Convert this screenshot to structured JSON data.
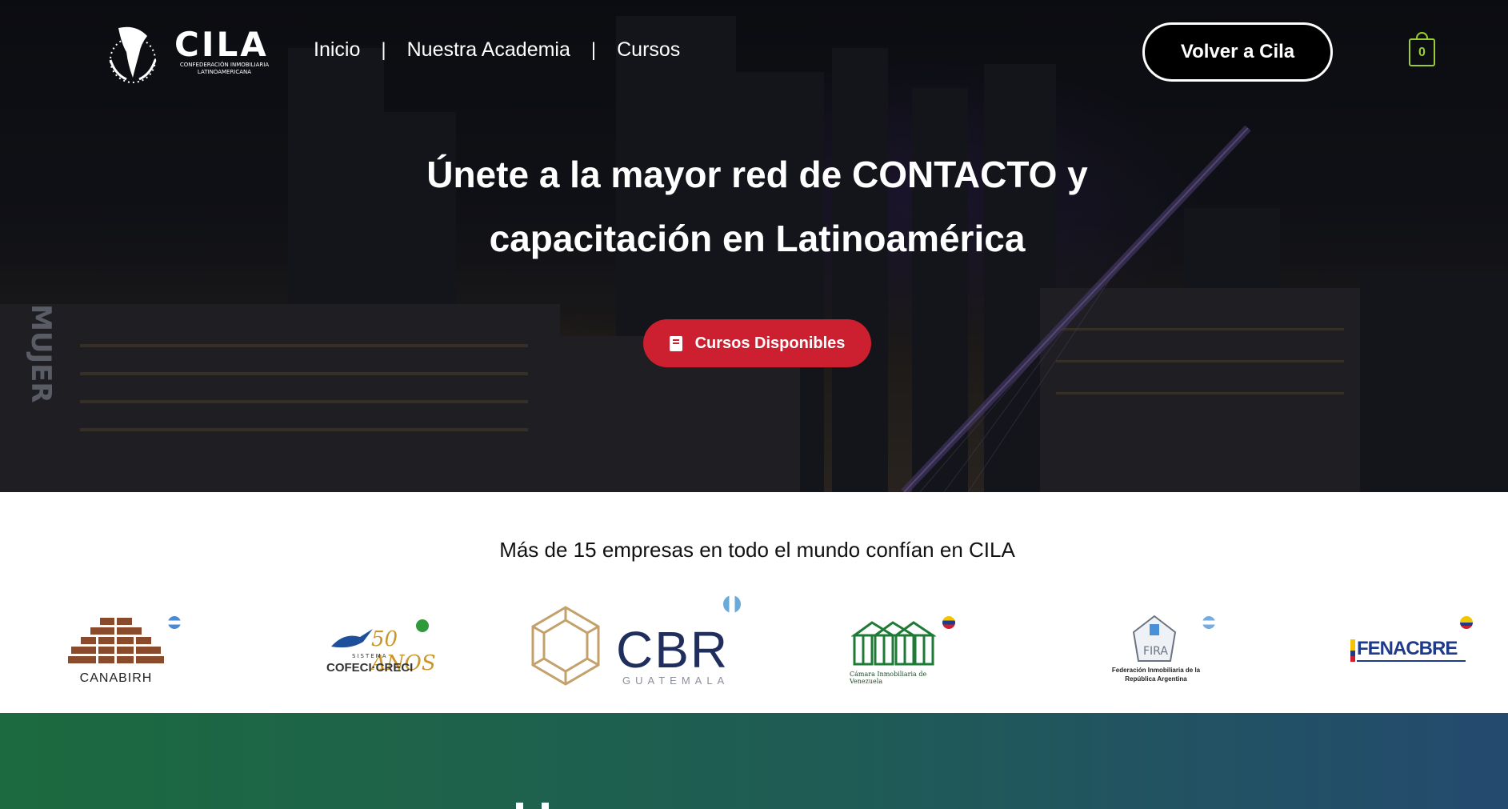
{
  "header": {
    "logo_text": "CILA",
    "logo_subtitle": "CONFEDERACIÓN INMOBILIARIA LATINOAMERICANA",
    "nav": [
      {
        "label": "Inicio"
      },
      {
        "label": "Nuestra Academia"
      },
      {
        "label": "Cursos"
      }
    ],
    "nav_separator": "|",
    "back_button": "Volver a Cila",
    "cart_count": "0"
  },
  "hero": {
    "title_line1": "Únete a la mayor red de CONTACTO y",
    "title_line2": "capacitación en Latinoamérica",
    "cta_label": "Cursos Disponibles",
    "cta_icon": "book-icon"
  },
  "partners": {
    "title": "Más de 15 empresas en todo el mundo confían en CILA",
    "logos": [
      {
        "name": "CANABIRH"
      },
      {
        "name": "COFECI·CRECI",
        "caption": "SISTEMA",
        "anniversary": "50 ANOS"
      },
      {
        "name": "CBR",
        "caption": "GUATEMALA"
      },
      {
        "name": "Cámara Inmobiliaria de Venezuela"
      },
      {
        "name": "Federación Inmobiliaria de la República Argentina"
      },
      {
        "name": "FENACBRE"
      }
    ]
  },
  "colors": {
    "accent_red": "#cc1f2f",
    "cart_green": "#9acd32",
    "section_green": "#1c6a3f",
    "section_blue": "#244a6e"
  }
}
